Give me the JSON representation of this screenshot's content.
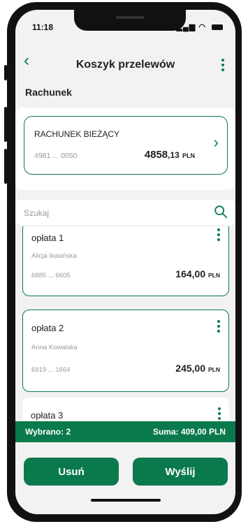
{
  "status": {
    "time": "11:18"
  },
  "header": {
    "title": "Koszyk przelewów"
  },
  "section": {
    "label": "Rachunek"
  },
  "account": {
    "name": "RACHUNEK BIEŻĄCY",
    "number": "4981 ... 0050",
    "balance_int": "4858",
    "balance_dec": ",13",
    "currency": "PLN"
  },
  "search": {
    "placeholder": "Szukaj"
  },
  "payments": [
    {
      "title": "opłata 1",
      "recipient": "Alicja Ikasińska",
      "account": "6885 ... 6605",
      "amount": "164,00",
      "currency": "PLN",
      "selected": true
    },
    {
      "title": "opłata 2",
      "recipient": "Anna Kowalska",
      "account": "6919 ... 1664",
      "amount": "245,00",
      "currency": "PLN",
      "selected": true
    },
    {
      "title": "opłata 3",
      "selected": false
    }
  ],
  "summary": {
    "selected": "Wybrano: 2",
    "total": "Suma: 409,00 PLN"
  },
  "actions": {
    "delete_label": "Usuń",
    "send_label": "Wyślij"
  },
  "colors": {
    "accent": "#0a7a4d",
    "background": "#f2f2f2"
  }
}
